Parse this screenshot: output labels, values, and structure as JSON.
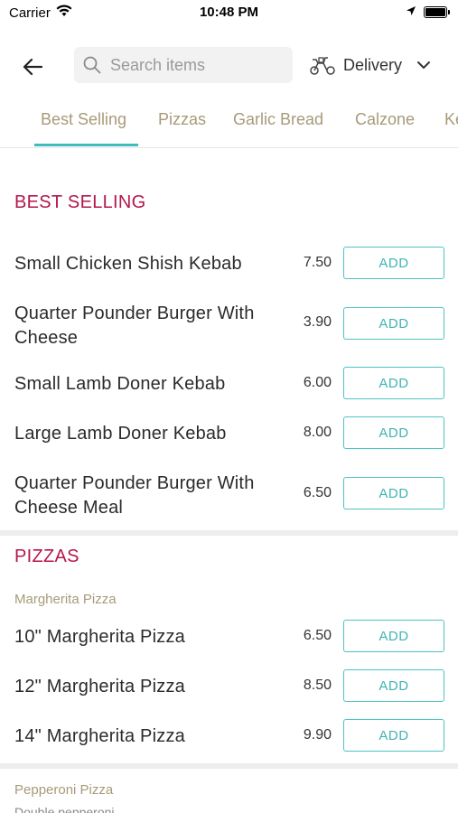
{
  "status": {
    "carrier": "Carrier",
    "time": "10:48 PM"
  },
  "header": {
    "search_placeholder": "Search items",
    "delivery_label": "Delivery"
  },
  "tabs": [
    {
      "label": "Best Selling",
      "active": true
    },
    {
      "label": "Pizzas",
      "active": false
    },
    {
      "label": "Garlic Bread",
      "active": false
    },
    {
      "label": "Calzone",
      "active": false
    },
    {
      "label": "Ke",
      "active": false
    }
  ],
  "add_label": "ADD",
  "sections": [
    {
      "title": "BEST SELLING",
      "items": [
        {
          "name": "Small Chicken Shish Kebab",
          "price": "7.50"
        },
        {
          "name": "Quarter Pounder Burger With Cheese",
          "price": "3.90"
        },
        {
          "name": "Small Lamb Doner Kebab",
          "price": "6.00"
        },
        {
          "name": "Large Lamb Doner Kebab",
          "price": "8.00"
        },
        {
          "name": "Quarter Pounder Burger With Cheese Meal",
          "price": "6.50"
        }
      ]
    },
    {
      "title": "PIZZAS",
      "groups": [
        {
          "name": "Margherita Pizza",
          "items": [
            {
              "name": "10\" Margherita Pizza",
              "price": "6.50"
            },
            {
              "name": "12\" Margherita Pizza",
              "price": "8.50"
            },
            {
              "name": "14\" Margherita Pizza",
              "price": "9.90"
            }
          ]
        },
        {
          "name": "Pepperoni Pizza",
          "description": "Double pepperoni"
        }
      ]
    }
  ],
  "colors": {
    "accent": "#3fbcbd",
    "section_title": "#b5174a",
    "subheading": "#a89a78"
  }
}
